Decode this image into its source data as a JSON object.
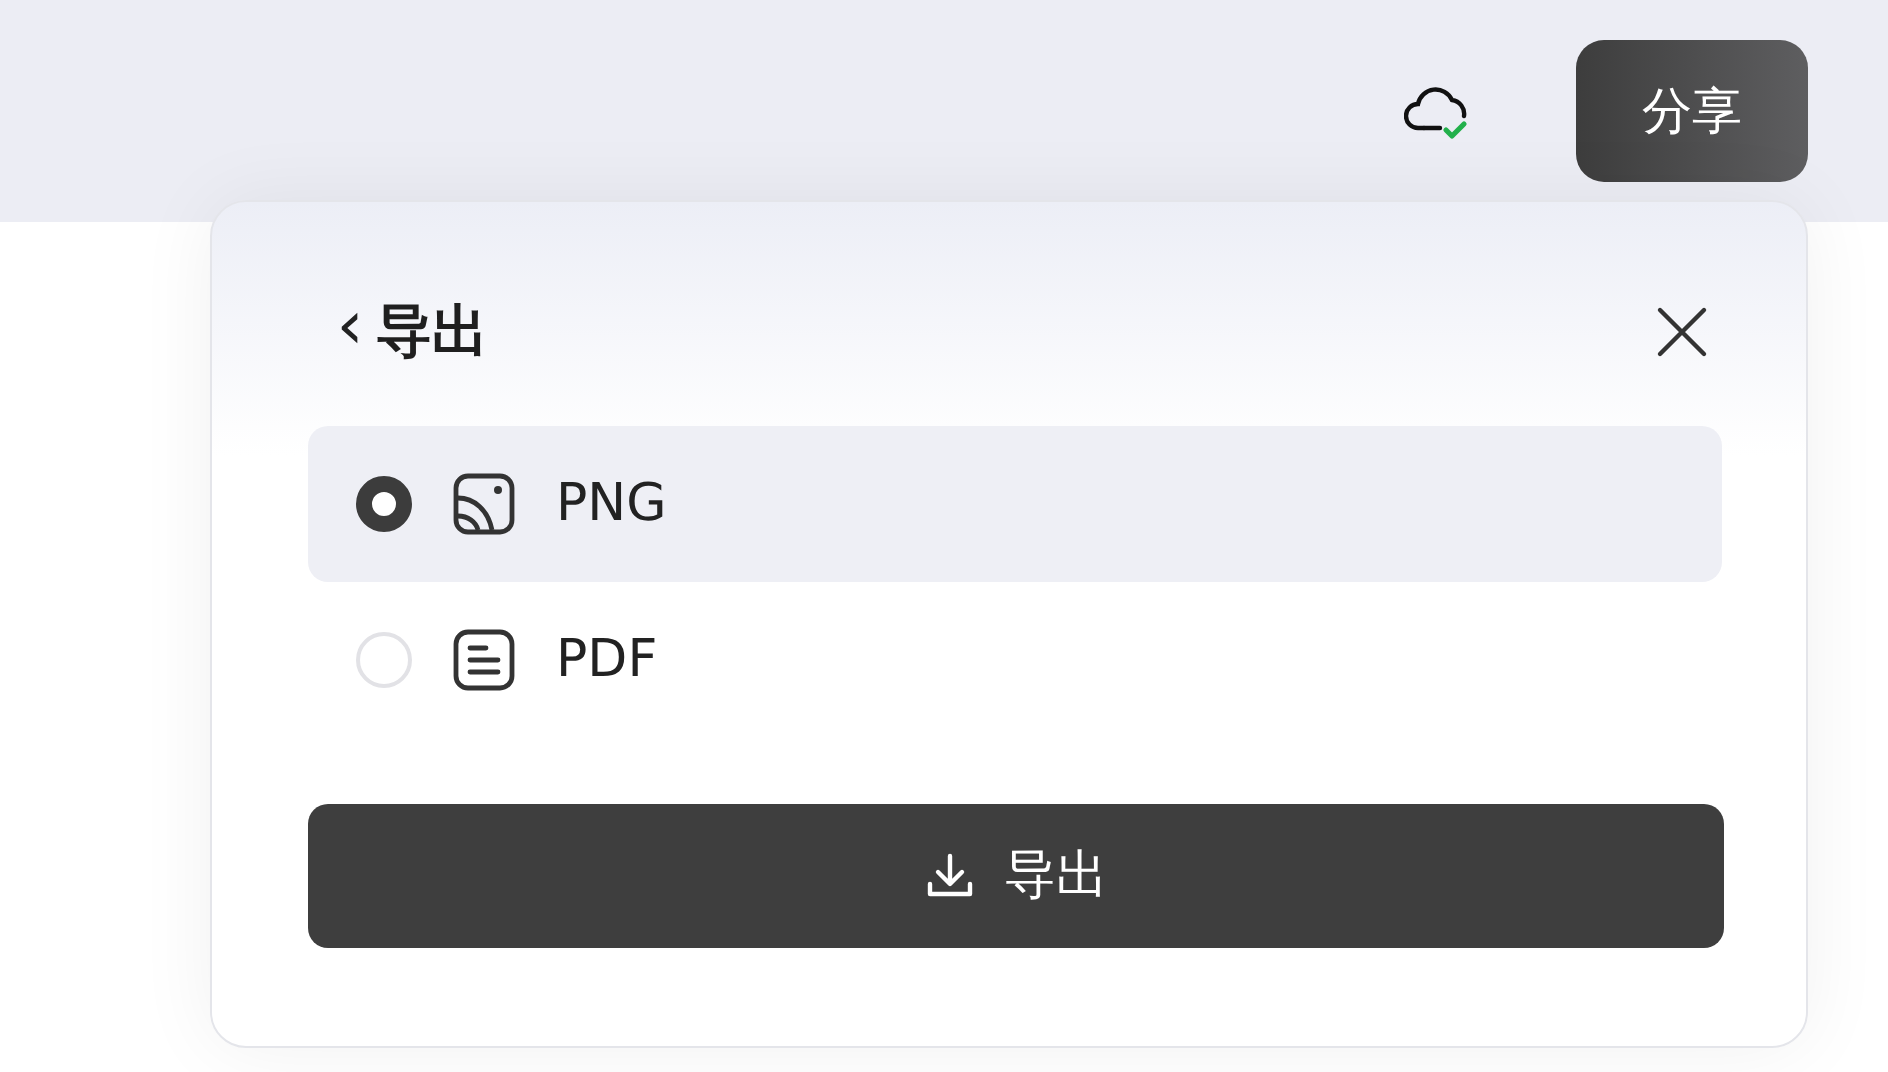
{
  "topbar": {
    "sync_ok": true,
    "share_button": "分享"
  },
  "export_panel": {
    "back": "‹",
    "title": "导出",
    "formats": [
      {
        "label": "PNG",
        "selected": true
      },
      {
        "label": "PDF",
        "selected": false
      }
    ],
    "export_button": "导出"
  }
}
